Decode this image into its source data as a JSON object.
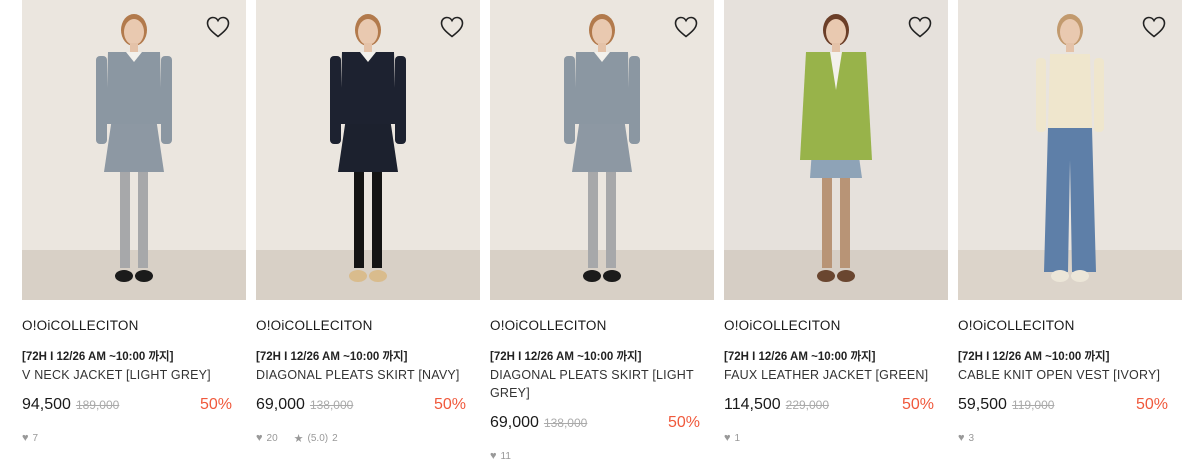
{
  "products": [
    {
      "brand": "O!OiCOLLECITON",
      "promo": "[72H I 12/26 AM ~10:00 까지]",
      "name": "V NECK JACKET [LIGHT GREY]",
      "price": "94,500",
      "original_price": "189,000",
      "discount": "50%",
      "likes": "7",
      "rating": "",
      "reviews": "",
      "colors": {
        "bg": "#ebe6df",
        "floor": "#d8d0c6",
        "top": "#8b97a2",
        "bottom": "#8d98a3",
        "legs": "#a7a8aa",
        "shoes": "#1b1b1b",
        "hair": "#b27a4c"
      }
    },
    {
      "brand": "O!OiCOLLECITON",
      "promo": "[72H I 12/26 AM ~10:00 까지]",
      "name": "DIAGONAL PLEATS SKIRT [NAVY]",
      "price": "69,000",
      "original_price": "138,000",
      "discount": "50%",
      "likes": "20",
      "rating": "(5.0)",
      "reviews": "2",
      "colors": {
        "bg": "#ebe6df",
        "floor": "#d8d0c6",
        "top": "#1d2230",
        "bottom": "#1c212e",
        "legs": "#141414",
        "shoes": "#d9bc8d",
        "hair": "#b27a4c"
      }
    },
    {
      "brand": "O!OiCOLLECITON",
      "promo": "[72H I 12/26 AM ~10:00 까지]",
      "name": "DIAGONAL PLEATS SKIRT [LIGHT GREY]",
      "price": "69,000",
      "original_price": "138,000",
      "discount": "50%",
      "likes": "11",
      "rating": "",
      "reviews": "",
      "colors": {
        "bg": "#ebe6df",
        "floor": "#d8d0c6",
        "top": "#8b97a2",
        "bottom": "#8d98a3",
        "legs": "#a7a8aa",
        "shoes": "#1b1b1b",
        "hair": "#b27a4c"
      }
    },
    {
      "brand": "O!OiCOLLECITON",
      "promo": "[72H I 12/26 AM ~10:00 까지]",
      "name": "FAUX LEATHER JACKET [GREEN]",
      "price": "114,500",
      "original_price": "229,000",
      "discount": "50%",
      "likes": "1",
      "rating": "",
      "reviews": "",
      "colors": {
        "bg": "#e6e1dc",
        "floor": "#d6cec5",
        "top": "#98b34a",
        "bottom": "#8ea3b7",
        "legs": "#b89476",
        "shoes": "#6a4630",
        "hair": "#6b3e28"
      }
    },
    {
      "brand": "O!OiCOLLECITON",
      "promo": "[72H I 12/26 AM ~10:00 까지]",
      "name": "CABLE KNIT OPEN VEST [IVORY]",
      "price": "59,500",
      "original_price": "119,000",
      "discount": "50%",
      "likes": "3",
      "rating": "",
      "reviews": "",
      "colors": {
        "bg": "#e9e4de",
        "floor": "#dcd4ca",
        "top": "#efe6cd",
        "bottom": "#5e7fa8",
        "legs": "#5e7fa8",
        "shoes": "#ece6d8",
        "hair": "#c29a6e"
      }
    }
  ]
}
